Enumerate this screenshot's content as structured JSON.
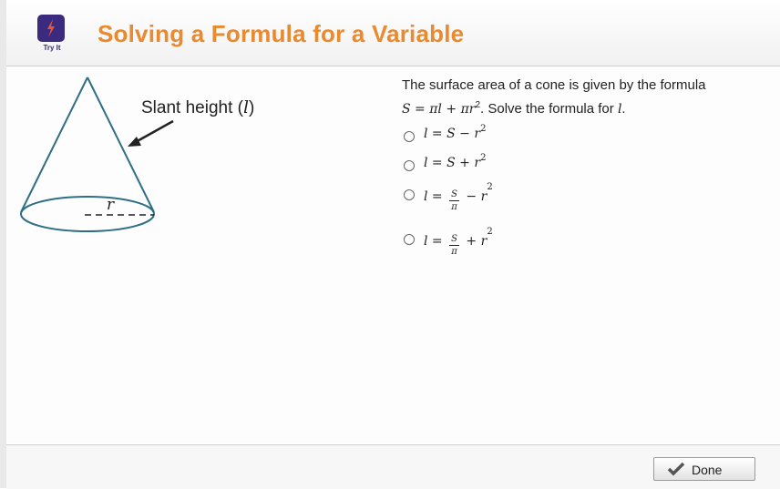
{
  "header": {
    "title": "Solving a Formula for a Variable",
    "badge_label": "Try It",
    "badge_icon": "lightning-icon",
    "accent_color": "#e98a2f",
    "badge_color": "#3b2b7e"
  },
  "diagram": {
    "slant_label_prefix": "Slant height (",
    "slant_label_var": "l",
    "slant_label_suffix": ")",
    "radius_label": "r",
    "stroke_color": "#2e6f86"
  },
  "question": {
    "line1": "The surface area of a cone is given by the formula",
    "formula_S": "S",
    "formula_eq": " = ",
    "formula_pil": "πl",
    "formula_plus": " + ",
    "formula_pir": "πr",
    "formula_exp": "2",
    "line2_text": ". Solve the formula for ",
    "line2_var": "l",
    "line2_end": "."
  },
  "options": [
    {
      "lhs": "l",
      "eq": " = ",
      "a": "S",
      "op": " − ",
      "b": "r",
      "exp": "2"
    },
    {
      "lhs": "l",
      "eq": " = ",
      "a": "S",
      "op": " + ",
      "b": "r",
      "exp": "2"
    },
    {
      "lhs": "l",
      "eq": " = ",
      "num": "S",
      "den": "π",
      "op": " − ",
      "b": "r",
      "exp": "2"
    },
    {
      "lhs": "l",
      "eq": " = ",
      "num": "S",
      "den": "π",
      "op": " + ",
      "b": "r",
      "exp": "2"
    }
  ],
  "footer": {
    "done_label": "Done"
  }
}
